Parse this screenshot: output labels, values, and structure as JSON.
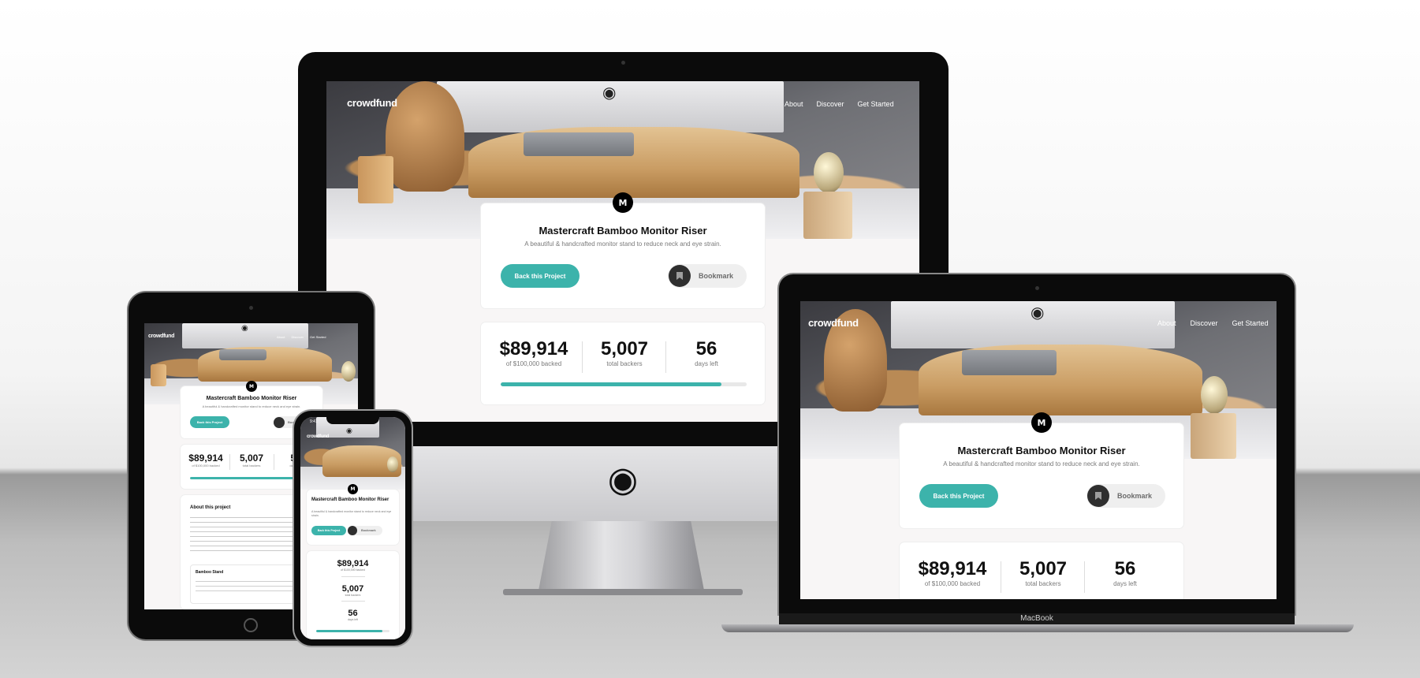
{
  "site": {
    "logo": "crowdfund",
    "nav": [
      "About",
      "Discover",
      "Get Started"
    ],
    "mark": "M",
    "project": {
      "title": "Mastercraft Bamboo Monitor Riser",
      "subtitle": "A beautiful & handcrafted monitor stand to reduce neck and eye strain.",
      "back_label": "Back this Project",
      "bookmark_label": "Bookmark"
    },
    "stats": [
      {
        "value": "$89,914",
        "label": "of $100,000 backed"
      },
      {
        "value": "5,007",
        "label": "total backers"
      },
      {
        "value": "56",
        "label": "days left"
      }
    ],
    "progress": 0.899,
    "about": {
      "heading": "About this project",
      "reward_title": "Bamboo Stand"
    }
  },
  "devices": {
    "laptop_brand": "MacBook",
    "phone_time": "9:41"
  },
  "colors": {
    "accent": "#3cb3ab",
    "dark": "#2f2f2f",
    "page_bg": "#f8f6f6"
  },
  "icons": [
    "apple-logo-icon",
    "bookmark-icon",
    "mastercraft-logo-icon",
    "camera-icon"
  ]
}
